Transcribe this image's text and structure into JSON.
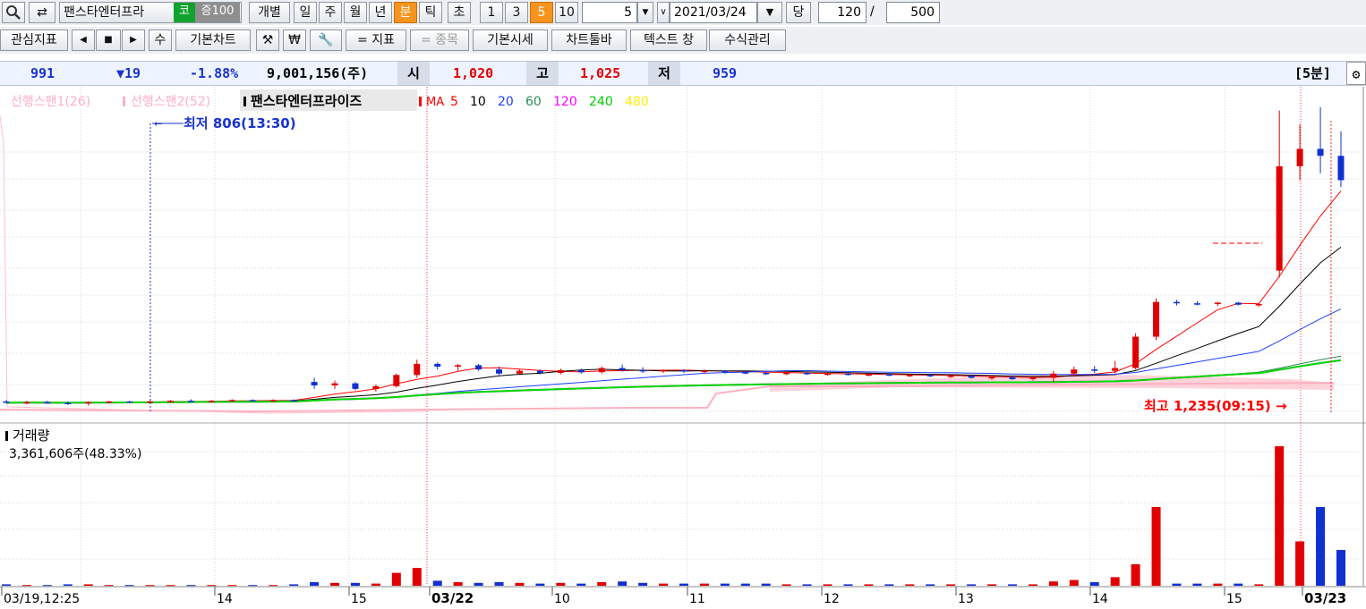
{
  "toolbar": {
    "stock_name": "팬스타엔터프라",
    "market_badge": "코",
    "margin_badge": "증100",
    "individual": "개별",
    "periods": [
      "일",
      "주",
      "월",
      "년",
      "분",
      "틱",
      "초"
    ],
    "active_period": "분",
    "intervals": [
      "1",
      "3",
      "5",
      "10"
    ],
    "active_interval": "5",
    "interval_value": "5",
    "date": "2021/03/24",
    "dang": "당",
    "count": "120",
    "slash": "/",
    "total": "500"
  },
  "toolbar2": {
    "watchlist": "관심지표",
    "su": "수",
    "basic_chart": "기본차트",
    "indicator": "= 지표",
    "stock": "= 종목",
    "basic_quote": "기본시세",
    "chart_toolbar": "차트툴바",
    "text_window": "텍스트 창",
    "formula": "수식관리",
    "won": "₩"
  },
  "info": {
    "price": "991",
    "change": "▼19",
    "change_pct": "-1.88%",
    "volume": "9,001,156(주)",
    "open_label": "시",
    "open": "1,020",
    "high_label": "고",
    "high": "1,025",
    "low_label": "저",
    "low": "959",
    "period_label": "[5분]"
  },
  "legend": {
    "span1": "선행스팬1(26)",
    "span2": "선행스팬2(52)",
    "stock": "팬스타엔터프라이즈",
    "ma_label": "MA",
    "ma": [
      {
        "period": "5",
        "color": "#ff0000"
      },
      {
        "period": "10",
        "color": "#000000"
      },
      {
        "period": "20",
        "color": "#1f3fff"
      },
      {
        "period": "60",
        "color": "#2e8b57"
      },
      {
        "period": "120",
        "color": "#ff00ff"
      },
      {
        "period": "240",
        "color": "#00cc00"
      },
      {
        "period": "480",
        "color": "#ffee00"
      }
    ]
  },
  "annotations": {
    "low": "최저 806(13:30)",
    "high": "최고 1,235(09:15)"
  },
  "volume_panel": {
    "title": "거래량",
    "value": "3,361,606주(48.33%)"
  },
  "chart_data": {
    "type": "candlestick",
    "interval": "5분",
    "ma_periods": [
      5,
      10,
      20,
      60,
      120,
      240,
      480
    ],
    "x_labels": [
      "03/19,12:25",
      "14",
      "15",
      "03/22",
      "10",
      "11",
      "12",
      "13",
      "14",
      "15",
      "03/23"
    ],
    "candles": [
      {
        "o": 812,
        "h": 814,
        "l": 809,
        "c": 810,
        "v": 0.02
      },
      {
        "o": 810,
        "h": 813,
        "l": 808,
        "c": 811,
        "v": 0.01
      },
      {
        "o": 811,
        "h": 813,
        "l": 809,
        "c": 810,
        "v": 0.01
      },
      {
        "o": 810,
        "h": 812,
        "l": 807,
        "c": 809,
        "v": 0.02
      },
      {
        "o": 809,
        "h": 812,
        "l": 806,
        "c": 811,
        "v": 0.02
      },
      {
        "o": 811,
        "h": 813,
        "l": 809,
        "c": 812,
        "v": 0.01
      },
      {
        "o": 812,
        "h": 813,
        "l": 810,
        "c": 811,
        "v": 0.01
      },
      {
        "o": 811,
        "h": 813,
        "l": 809,
        "c": 812,
        "v": 0.01
      },
      {
        "o": 812,
        "h": 814,
        "l": 810,
        "c": 813,
        "v": 0.01
      },
      {
        "o": 813,
        "h": 815,
        "l": 811,
        "c": 812,
        "v": 0.01
      },
      {
        "o": 812,
        "h": 814,
        "l": 810,
        "c": 813,
        "v": 0.01
      },
      {
        "o": 813,
        "h": 815,
        "l": 811,
        "c": 814,
        "v": 0.01
      },
      {
        "o": 814,
        "h": 815,
        "l": 812,
        "c": 813,
        "v": 0.01
      },
      {
        "o": 813,
        "h": 815,
        "l": 811,
        "c": 814,
        "v": 0.01
      },
      {
        "o": 814,
        "h": 815,
        "l": 812,
        "c": 813,
        "v": 0.02
      },
      {
        "o": 840,
        "h": 846,
        "l": 830,
        "c": 835,
        "v": 0.05
      },
      {
        "o": 835,
        "h": 842,
        "l": 830,
        "c": 838,
        "v": 0.04
      },
      {
        "o": 838,
        "h": 840,
        "l": 828,
        "c": 830,
        "v": 0.04
      },
      {
        "o": 830,
        "h": 836,
        "l": 826,
        "c": 834,
        "v": 0.03
      },
      {
        "o": 834,
        "h": 852,
        "l": 832,
        "c": 850,
        "v": 0.18
      },
      {
        "o": 850,
        "h": 872,
        "l": 846,
        "c": 866,
        "v": 0.25
      },
      {
        "o": 866,
        "h": 868,
        "l": 858,
        "c": 862,
        "v": 0.07
      },
      {
        "o": 862,
        "h": 866,
        "l": 856,
        "c": 864,
        "v": 0.05
      },
      {
        "o": 864,
        "h": 866,
        "l": 856,
        "c": 858,
        "v": 0.04
      },
      {
        "o": 858,
        "h": 862,
        "l": 850,
        "c": 852,
        "v": 0.05
      },
      {
        "o": 852,
        "h": 858,
        "l": 850,
        "c": 856,
        "v": 0.04
      },
      {
        "o": 856,
        "h": 858,
        "l": 851,
        "c": 853,
        "v": 0.03
      },
      {
        "o": 853,
        "h": 859,
        "l": 851,
        "c": 857,
        "v": 0.04
      },
      {
        "o": 857,
        "h": 859,
        "l": 852,
        "c": 854,
        "v": 0.03
      },
      {
        "o": 854,
        "h": 862,
        "l": 852,
        "c": 860,
        "v": 0.05
      },
      {
        "o": 860,
        "h": 865,
        "l": 855,
        "c": 857,
        "v": 0.06
      },
      {
        "o": 857,
        "h": 861,
        "l": 853,
        "c": 856,
        "v": 0.04
      },
      {
        "o": 856,
        "h": 858,
        "l": 853,
        "c": 857,
        "v": 0.03
      },
      {
        "o": 857,
        "h": 858,
        "l": 853,
        "c": 855,
        "v": 0.03
      },
      {
        "o": 855,
        "h": 858,
        "l": 852,
        "c": 856,
        "v": 0.03
      },
      {
        "o": 856,
        "h": 857,
        "l": 852,
        "c": 854,
        "v": 0.03
      },
      {
        "o": 854,
        "h": 856,
        "l": 851,
        "c": 853,
        "v": 0.03
      },
      {
        "o": 853,
        "h": 855,
        "l": 850,
        "c": 852,
        "v": 0.03
      },
      {
        "o": 852,
        "h": 854,
        "l": 850,
        "c": 853,
        "v": 0.02
      },
      {
        "o": 853,
        "h": 854,
        "l": 850,
        "c": 851,
        "v": 0.02
      },
      {
        "o": 851,
        "h": 853,
        "l": 849,
        "c": 852,
        "v": 0.02
      },
      {
        "o": 852,
        "h": 853,
        "l": 849,
        "c": 850,
        "v": 0.02
      },
      {
        "o": 850,
        "h": 852,
        "l": 848,
        "c": 851,
        "v": 0.02
      },
      {
        "o": 851,
        "h": 852,
        "l": 848,
        "c": 849,
        "v": 0.02
      },
      {
        "o": 849,
        "h": 851,
        "l": 847,
        "c": 850,
        "v": 0.02
      },
      {
        "o": 850,
        "h": 851,
        "l": 847,
        "c": 848,
        "v": 0.02
      },
      {
        "o": 848,
        "h": 850,
        "l": 846,
        "c": 849,
        "v": 0.02
      },
      {
        "o": 849,
        "h": 850,
        "l": 845,
        "c": 846,
        "v": 0.02
      },
      {
        "o": 846,
        "h": 848,
        "l": 843,
        "c": 847,
        "v": 0.02
      },
      {
        "o": 847,
        "h": 848,
        "l": 843,
        "c": 844,
        "v": 0.02
      },
      {
        "o": 844,
        "h": 847,
        "l": 842,
        "c": 846,
        "v": 0.02
      },
      {
        "o": 846,
        "h": 856,
        "l": 840,
        "c": 852,
        "v": 0.06
      },
      {
        "o": 852,
        "h": 862,
        "l": 849,
        "c": 858,
        "v": 0.08
      },
      {
        "o": 858,
        "h": 863,
        "l": 853,
        "c": 856,
        "v": 0.05
      },
      {
        "o": 856,
        "h": 870,
        "l": 852,
        "c": 860,
        "v": 0.12
      },
      {
        "o": 860,
        "h": 910,
        "l": 858,
        "c": 905,
        "v": 0.3
      },
      {
        "o": 905,
        "h": 960,
        "l": 900,
        "c": 955,
        "v": 1.1
      },
      {
        "o": 955,
        "h": 958,
        "l": 950,
        "c": 953,
        "v": 0.03
      },
      {
        "o": 953,
        "h": 956,
        "l": 950,
        "c": 952,
        "v": 0.03
      },
      {
        "o": 952,
        "h": 955,
        "l": 949,
        "c": 954,
        "v": 0.03
      },
      {
        "o": 954,
        "h": 955,
        "l": 950,
        "c": 951,
        "v": 0.03
      },
      {
        "o": 951,
        "h": 953,
        "l": 948,
        "c": 952,
        "v": 0.02
      },
      {
        "o": 1000,
        "h": 1230,
        "l": 990,
        "c": 1150,
        "v": 1.95
      },
      {
        "o": 1150,
        "h": 1210,
        "l": 1130,
        "c": 1175,
        "v": 0.62
      },
      {
        "o": 1175,
        "h": 1235,
        "l": 1140,
        "c": 1165,
        "v": 1.1
      },
      {
        "o": 1165,
        "h": 1200,
        "l": 1120,
        "c": 1130,
        "v": 0.5
      }
    ]
  }
}
